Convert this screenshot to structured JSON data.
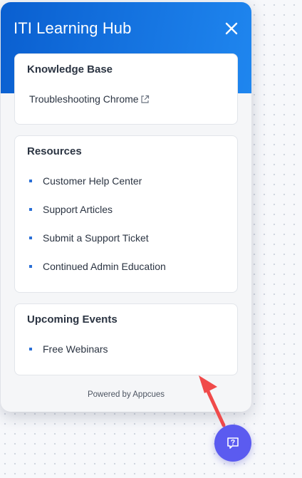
{
  "header": {
    "title": "ITI Learning Hub"
  },
  "knowledge_base": {
    "title": "Knowledge Base",
    "link": "Troubleshooting Chrome"
  },
  "resources": {
    "title": "Resources",
    "items": [
      {
        "label": "Customer Help Center"
      },
      {
        "label": "Support Articles"
      },
      {
        "label": "Submit a Support Ticket"
      },
      {
        "label": "Continued Admin Education"
      }
    ]
  },
  "events": {
    "title": "Upcoming Events",
    "items": [
      {
        "label": "Free Webinars"
      }
    ]
  },
  "footer": {
    "powered_by": "Powered by Appcues"
  },
  "icons": {
    "close": "close-icon",
    "external_link": "external-link-icon",
    "launcher": "help-question-icon",
    "annotation": "red-arrow-icon"
  },
  "colors": {
    "header_start": "#0a5fd0",
    "header_end": "#1f86ef",
    "bullet": "#2a6fd6",
    "launcher": "#5b5bf0",
    "arrow": "#f04a4a"
  }
}
